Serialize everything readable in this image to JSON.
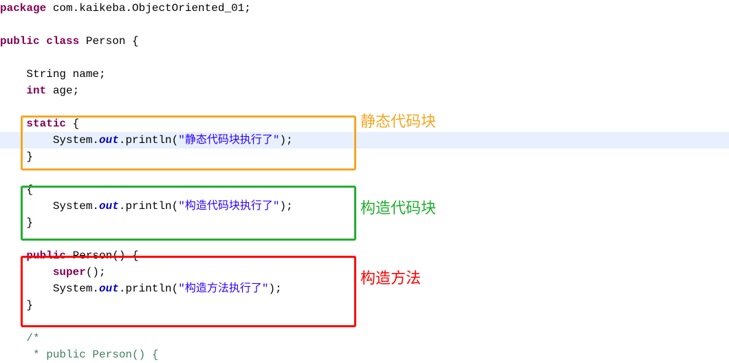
{
  "code": {
    "l1_package": "package",
    "l1_rest": " com.kaikeba.ObjectOriented_01;",
    "l3_public": "public",
    "l3_class": "class",
    "l3_rest": " Person {",
    "l5_indent": "    ",
    "l5_type": "String",
    "l5_rest": " name;",
    "l6_indent": "    ",
    "l6_type": "int",
    "l6_rest": " age;",
    "l8_indent": "    ",
    "l8_static": "static",
    "l8_rest": " {",
    "l9_indent": "        System.",
    "l9_out": "out",
    "l9_mid": ".println(",
    "l9_str": "\"静态代码块执行了\"",
    "l9_end": ");",
    "l10": "    }",
    "l12": "    {",
    "l13_indent": "        System.",
    "l13_out": "out",
    "l13_mid": ".println(",
    "l13_str": "\"构造代码块执行了\"",
    "l13_end": ");",
    "l14": "    }",
    "l16_indent": "    ",
    "l16_public": "public",
    "l16_rest": " Person() {",
    "l17_indent": "        ",
    "l17_super": "super",
    "l17_rest": "();",
    "l18_indent": "        System.",
    "l18_out": "out",
    "l18_mid": ".println(",
    "l18_str": "\"构造方法执行了\"",
    "l18_end": ");",
    "l19": "    }",
    "l21": "    /*",
    "l22": "     * public Person() {"
  },
  "annotations": {
    "static_block": "静态代码块",
    "init_block": "构造代码块",
    "constructor": "构造方法"
  }
}
